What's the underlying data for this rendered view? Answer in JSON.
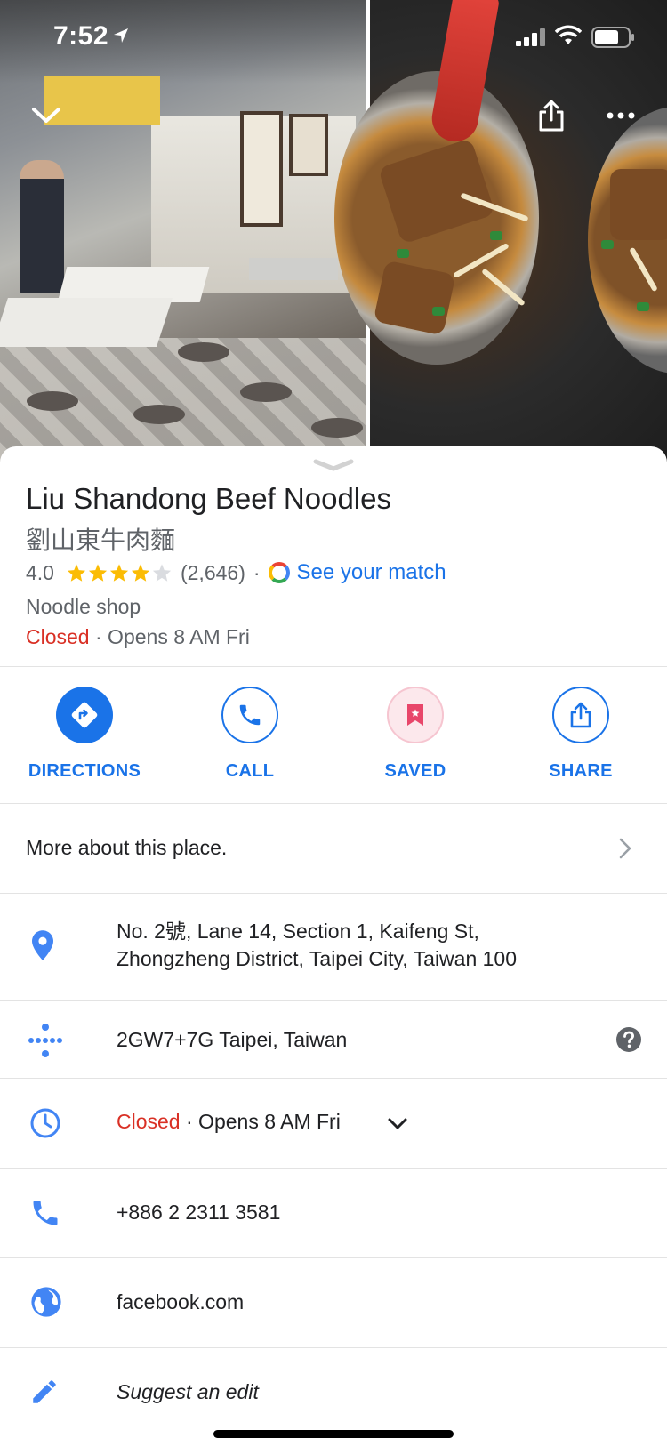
{
  "status_bar": {
    "time": "7:52"
  },
  "place": {
    "name": "Liu Shandong Beef Noodles",
    "native_name": "劉山東牛肉麵",
    "rating": "4.0",
    "stars": 4,
    "review_count": "(2,646)",
    "separator": "·",
    "match_label": "See your match",
    "category": "Noodle shop",
    "status": "Closed",
    "opens": "· Opens 8 AM Fri"
  },
  "actions": [
    {
      "label": "DIRECTIONS",
      "icon": "directions-icon"
    },
    {
      "label": "CALL",
      "icon": "phone-icon"
    },
    {
      "label": "SAVED",
      "icon": "bookmark-icon"
    },
    {
      "label": "SHARE",
      "icon": "share-icon"
    }
  ],
  "more_about": "More about this place.",
  "details": {
    "address_line1": "No. 2號, Lane 14, Section 1, Kaifeng St,",
    "address_line2": "Zhongzheng District, Taipei City, Taiwan 100",
    "plus_code": "2GW7+7G Taipei, Taiwan",
    "hours_status": "Closed",
    "hours_opens": "· Opens 8 AM Fri",
    "phone": "+886 2 2311 3581",
    "website": "facebook.com",
    "suggest_edit": "Suggest an edit"
  },
  "colors": {
    "accent": "#1a73e8",
    "closed": "#d93025",
    "star": "#fbbc04",
    "saved_bg": "#fce8ec",
    "saved_icon": "#e8466a"
  }
}
